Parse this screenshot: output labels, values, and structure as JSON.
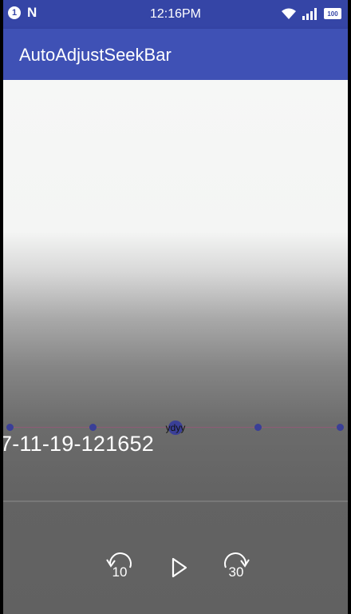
{
  "status_bar": {
    "notification_count": "1",
    "time": "12:16PM",
    "battery": "100"
  },
  "app_bar": {
    "title": "AutoAdjustSeekBar"
  },
  "seekbar": {
    "thumb_label": "ydyy",
    "node_count": 5,
    "selected_index": 2
  },
  "video": {
    "title": "7-11-19-121652"
  },
  "controls": {
    "replay_seconds": "10",
    "forward_seconds": "30"
  },
  "colors": {
    "status_bar": "#3545a6",
    "app_bar": "#3f51b5",
    "seek_node": "#3a3f97",
    "seek_track": "#8f5a76"
  },
  "icons": [
    "notification-icon",
    "n-logo-icon",
    "wifi-icon",
    "signal-icon",
    "battery-icon",
    "replay-icon",
    "play-icon",
    "forward-icon"
  ]
}
